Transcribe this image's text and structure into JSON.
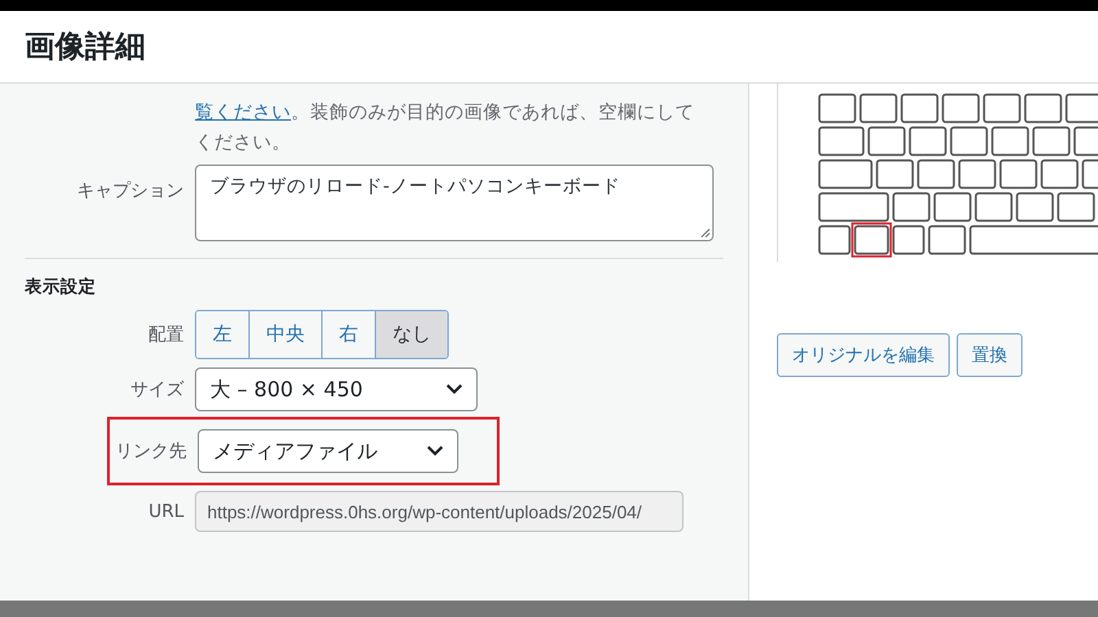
{
  "window": {
    "title": "画像詳細"
  },
  "alt_help": {
    "link": "覧ください",
    "text": "。装飾のみが目的の画像であれば、空欄にしてください。"
  },
  "caption": {
    "label": "キャプション",
    "value": "ブラウザのリロード-ノートパソコンキーボード"
  },
  "display_settings": {
    "heading": "表示設定",
    "alignment": {
      "label": "配置",
      "options": [
        {
          "label": "左",
          "selected": false
        },
        {
          "label": "中央",
          "selected": false
        },
        {
          "label": "右",
          "selected": false
        },
        {
          "label": "なし",
          "selected": true
        }
      ]
    },
    "size": {
      "label": "サイズ",
      "value": "大 – 800 × 450"
    },
    "link_to": {
      "label": "リンク先",
      "value": "メディアファイル",
      "highlighted": true
    },
    "url": {
      "label": "URL",
      "value": "https://wordpress.0hs.org/wp-content/uploads/2025/04/"
    }
  },
  "actions": [
    "オリジナルを編集",
    "置換"
  ]
}
